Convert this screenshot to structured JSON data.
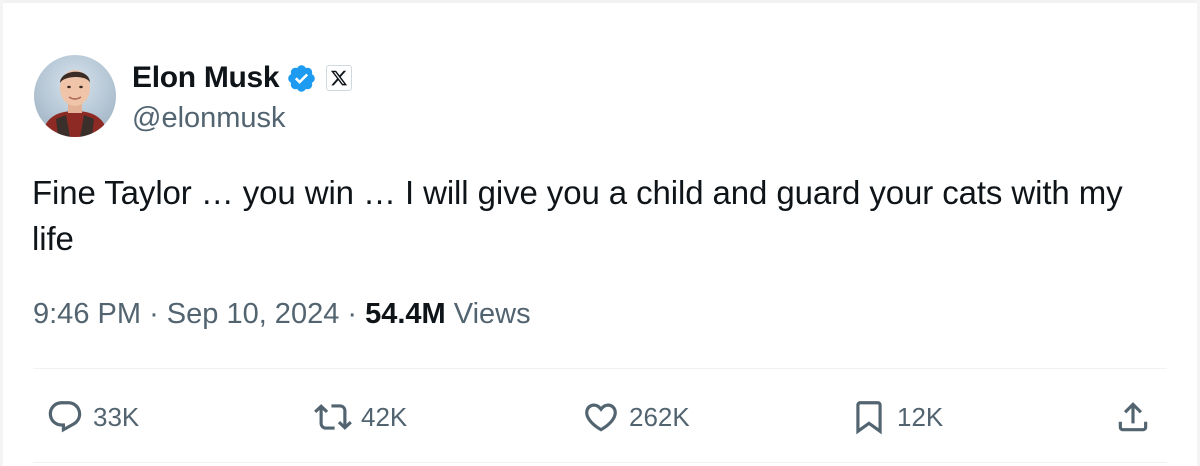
{
  "user": {
    "display_name": "Elon Musk",
    "handle": "@elonmusk"
  },
  "tweet": {
    "text": "Fine Taylor … you win … I will give you a child and guard your cats with my life"
  },
  "meta": {
    "time": "9:46 PM",
    "separator": "·",
    "date": "Sep 10, 2024",
    "views_count": "54.4M",
    "views_label": "Views"
  },
  "actions": {
    "replies": "33K",
    "reposts": "42K",
    "likes": "262K",
    "bookmarks": "12K"
  },
  "icons": {
    "reply": "reply-icon",
    "repost": "repost-icon",
    "like": "heart-icon",
    "bookmark": "bookmark-icon",
    "share": "share-icon",
    "verified": "verified-badge-icon",
    "affiliate": "x-logo-icon"
  },
  "colors": {
    "verified_blue": "#1d9bf0",
    "text_primary": "#0f1419",
    "text_secondary": "#536471",
    "divider": "#eff3f4"
  }
}
